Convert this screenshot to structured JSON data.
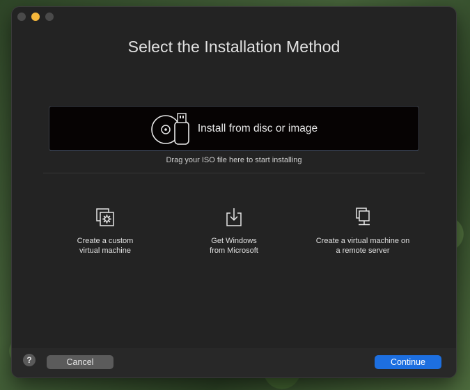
{
  "window": {
    "title": "Select the Installation Method"
  },
  "drop_zone": {
    "label": "Install from disc or image",
    "hint": "Drag your ISO file here to start installing",
    "icon": "disc-usb-icon"
  },
  "options": [
    {
      "label_line1": "Create a custom",
      "label_line2": "virtual machine",
      "icon": "custom-vm-icon"
    },
    {
      "label_line1": "Get Windows",
      "label_line2": "from Microsoft",
      "icon": "download-icon"
    },
    {
      "label_line1": "Create a virtual machine on",
      "label_line2": "a remote server",
      "icon": "remote-server-icon"
    }
  ],
  "footer": {
    "help_label": "?",
    "cancel_label": "Cancel",
    "continue_label": "Continue"
  },
  "colors": {
    "window_bg": "#232323",
    "accent": "#1d6fe0",
    "minimize": "#f5b73b"
  }
}
